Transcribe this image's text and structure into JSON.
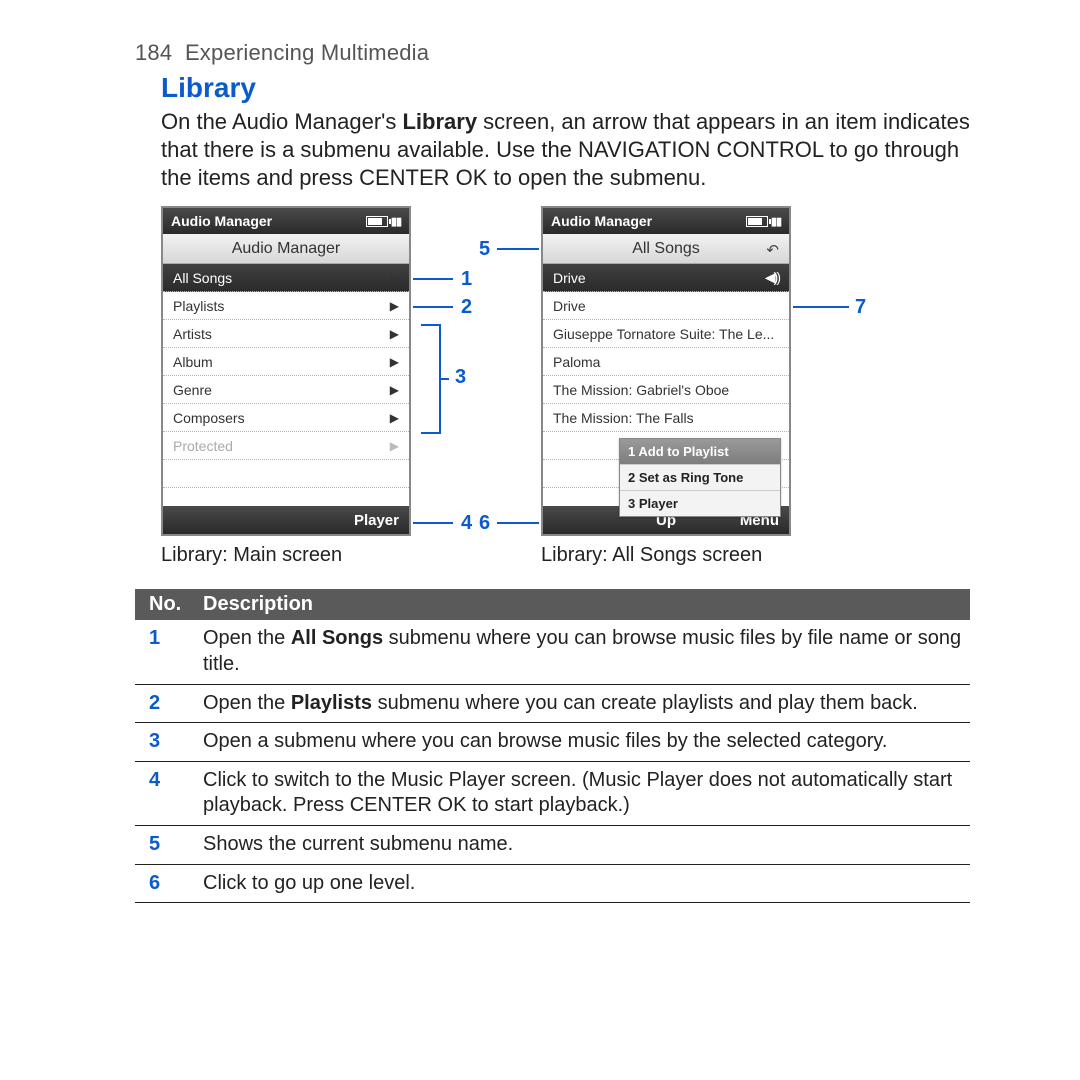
{
  "page": {
    "number": "184",
    "chapter": "Experiencing Multimedia"
  },
  "section": {
    "title": "Library"
  },
  "intro": {
    "pre": "On the Audio Manager's ",
    "bold1": "Library",
    "post": " screen, an arrow that appears in an item indicates that there is a submenu available. Use the NAVIGATION CONTROL to go through the items and press CENTER OK to open the submenu."
  },
  "screen1": {
    "titlebar": "Audio Manager",
    "subtitle": "Audio Manager",
    "items": {
      "r1": "All Songs",
      "r2": "Playlists",
      "r3": "Artists",
      "r4": "Album",
      "r5": "Genre",
      "r6": "Composers",
      "r7": "Protected"
    },
    "soft": {
      "left": "",
      "mid": "",
      "right": "Player"
    },
    "caption": "Library: Main screen"
  },
  "screen2": {
    "titlebar": "Audio Manager",
    "subtitle": "All Songs",
    "items": {
      "r1": "Drive",
      "r2": "Drive",
      "r3": "Giuseppe Tornatore Suite: The Le...",
      "r4": "Paloma",
      "r5": "The Mission: Gabriel's Oboe",
      "r6": "The Mission: The Falls"
    },
    "ctx": {
      "i1": "1 Add to Playlist",
      "i2": "2 Set as Ring Tone",
      "i3": "3 Player"
    },
    "soft": {
      "left": "",
      "mid": "Up",
      "right": "Menu"
    },
    "caption": "Library: All Songs screen"
  },
  "callouts": {
    "c1": "1",
    "c2": "2",
    "c3": "3",
    "c4": "4",
    "c5": "5",
    "c6": "6",
    "c7": "7"
  },
  "descHead": {
    "no": "No.",
    "desc": "Description"
  },
  "desc": {
    "r1": {
      "n": "1",
      "pre": "Open the ",
      "b": "All Songs",
      "post": " submenu where you can browse music files by file name or song title."
    },
    "r2": {
      "n": "2",
      "pre": "Open the ",
      "b": "Playlists",
      "post": " submenu where you can create playlists and play them back."
    },
    "r3": {
      "n": "3",
      "t": "Open a submenu where you can browse music files by the selected category."
    },
    "r4": {
      "n": "4",
      "t": "Click to switch to the Music Player screen. (Music Player does not automatically start playback. Press CENTER OK to start playback.)"
    },
    "r5": {
      "n": "5",
      "t": "Shows the current submenu name."
    },
    "r6": {
      "n": "6",
      "t": "Click to go up one level."
    }
  }
}
